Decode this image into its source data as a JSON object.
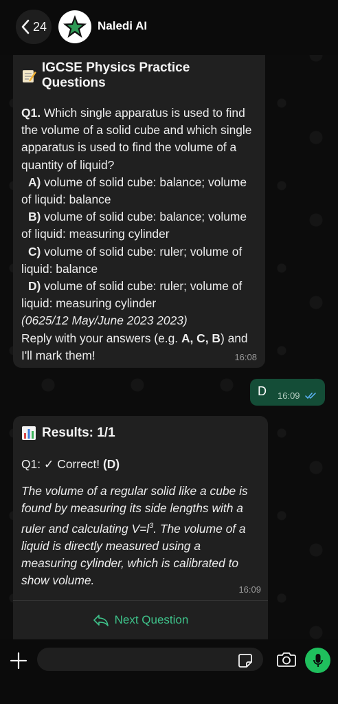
{
  "header": {
    "back_count": "24",
    "contact_name": "Naledi AI"
  },
  "messages": {
    "question": {
      "title": "IGCSE Physics Practice Questions",
      "q_label": "Q1.",
      "q_text": " Which single apparatus is used to find the volume of a solid cube and which single apparatus is used to find the volume of a quantity of liquid?",
      "options": [
        {
          "letter": "A)",
          "text": " volume of solid cube: balance; volume of liquid: balance"
        },
        {
          "letter": "B)",
          "text": " volume of solid cube: balance; volume of liquid: measuring cylinder"
        },
        {
          "letter": "C)",
          "text": " volume of solid cube: ruler; volume of liquid: balance"
        },
        {
          "letter": "D)",
          "text": " volume of solid cube: ruler; volume of liquid: measuring cylinder"
        }
      ],
      "source": "(0625/12 May/June 2023 2023)",
      "reply_prefix": "Reply with your answers (e.g. ",
      "reply_example": "A, C, B",
      "reply_suffix": ") and I'll mark them!",
      "time": "16:08"
    },
    "answer": {
      "text": "D",
      "time": "16:09"
    },
    "result": {
      "title": "Results: 1/1",
      "line_prefix": "Q1: ✓ Correct! ",
      "line_answer": "(D)",
      "explanation_1": "The volume of a regular solid like a cube is found by measuring its side lengths with a ruler and calculating V=l",
      "explanation_sup": "3",
      "explanation_2": ". The volume of a liquid is directly measured using a measuring cylinder, which is calibrated to show volume.",
      "time": "16:09",
      "next_button": "Next Question"
    }
  },
  "composer": {
    "placeholder": ""
  },
  "colors": {
    "outgoing_bubble": "#144d37",
    "incoming_bubble": "#202020",
    "accent_green": "#3ec28a",
    "mic_green": "#1fbf5d"
  }
}
